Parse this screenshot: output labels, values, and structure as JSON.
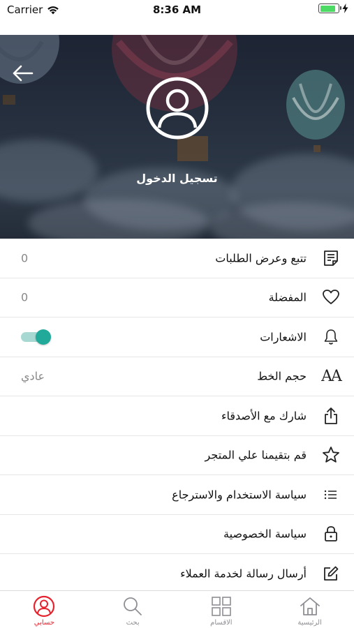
{
  "status_bar": {
    "carrier": "Carrier",
    "time": "8:36 AM",
    "battery_level": 0.85,
    "battery_color": "#4cd964"
  },
  "hero": {
    "login_label": "تسجيل الدخول",
    "back_icon": "arrow-left-icon",
    "avatar_icon": "user-circle-icon"
  },
  "menu": {
    "items": [
      {
        "label": "تتبع وعرض الطلبات",
        "value": "0",
        "icon": "orders-document-icon"
      },
      {
        "label": "المفضلة",
        "value": "0",
        "icon": "heart-icon"
      },
      {
        "label": "الاشعارات",
        "toggle_on": true,
        "icon": "bell-icon"
      },
      {
        "label": "حجم الخط",
        "value": "عادي",
        "icon": "font-size-icon",
        "icon_text": "AA"
      },
      {
        "label": "شارك مع الأصدقاء",
        "icon": "share-icon"
      },
      {
        "label": "قم بتقيمنا علي المتجر",
        "icon": "star-icon"
      },
      {
        "label": "سياسة الاستخدام والاسترجاع",
        "icon": "list-icon"
      },
      {
        "label": "سياسة الخصوصية",
        "icon": "lock-icon"
      },
      {
        "label": "أرسال رسالة لخدمة العملاء",
        "icon": "edit-icon"
      }
    ],
    "toggle_color": "#21a99a"
  },
  "tab_bar": {
    "active_color": "#e5232e",
    "tabs": [
      {
        "label": "الرئيسية",
        "icon": "home-icon"
      },
      {
        "label": "الاقسام",
        "icon": "grid-icon"
      },
      {
        "label": "بحث",
        "icon": "search-icon"
      },
      {
        "label": "حسابي",
        "icon": "account-icon",
        "active": true
      }
    ]
  }
}
